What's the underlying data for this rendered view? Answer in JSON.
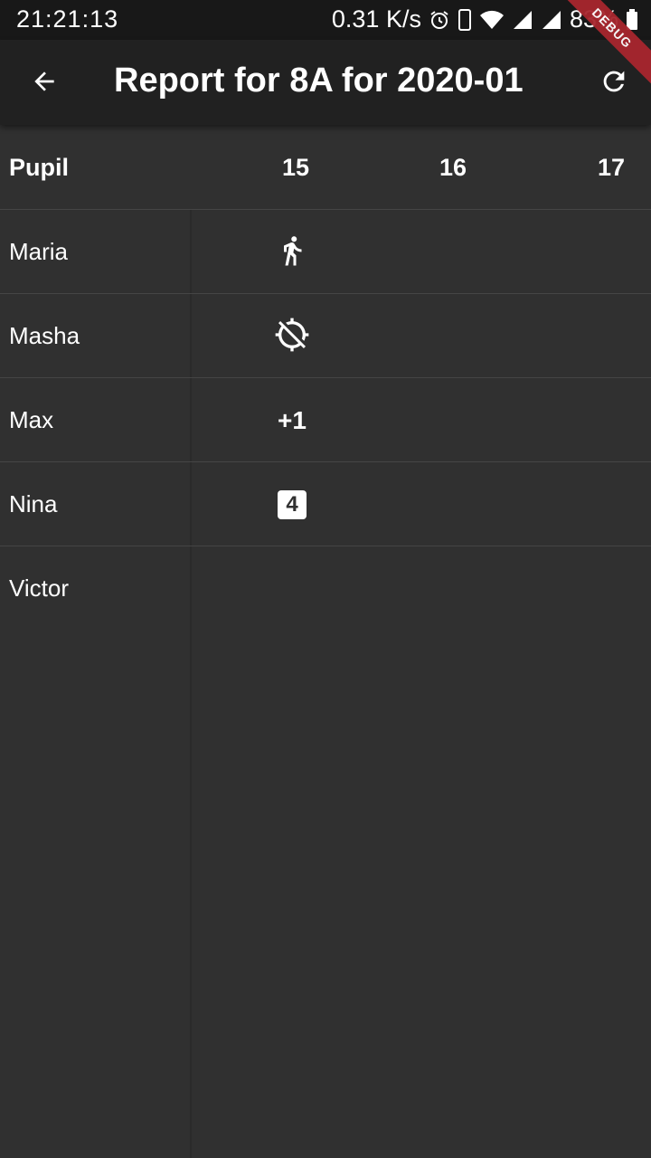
{
  "status_bar": {
    "time": "21:21:13",
    "net_speed": "0.31 K/s",
    "battery": "83%",
    "icons": [
      "alarm-icon",
      "phone-icon",
      "wifi-icon",
      "signal-icon",
      "signal-icon-2",
      "battery-icon"
    ]
  },
  "app_bar": {
    "title": "Report for 8A for 2020-01",
    "back_icon": "arrow-back-icon",
    "refresh_icon": "refresh-icon",
    "debug_label": "DEBUG"
  },
  "table": {
    "pupil_header": "Pupil",
    "days": [
      "15",
      "16",
      "17"
    ],
    "rows": [
      {
        "name": "Maria",
        "mark": {
          "type": "icon",
          "icon": "walking-person-icon"
        }
      },
      {
        "name": "Masha",
        "mark": {
          "type": "icon",
          "icon": "location-disabled-icon"
        }
      },
      {
        "name": "Max",
        "mark": {
          "type": "text",
          "text": "+1"
        }
      },
      {
        "name": "Nina",
        "mark": {
          "type": "grade",
          "text": "4"
        }
      },
      {
        "name": "Victor",
        "mark": null
      }
    ]
  },
  "colors": {
    "background": "#303030",
    "app_bar": "#212121",
    "status_bar": "#181818",
    "debug_banner": "#a8262e",
    "text": "#ffffff"
  }
}
